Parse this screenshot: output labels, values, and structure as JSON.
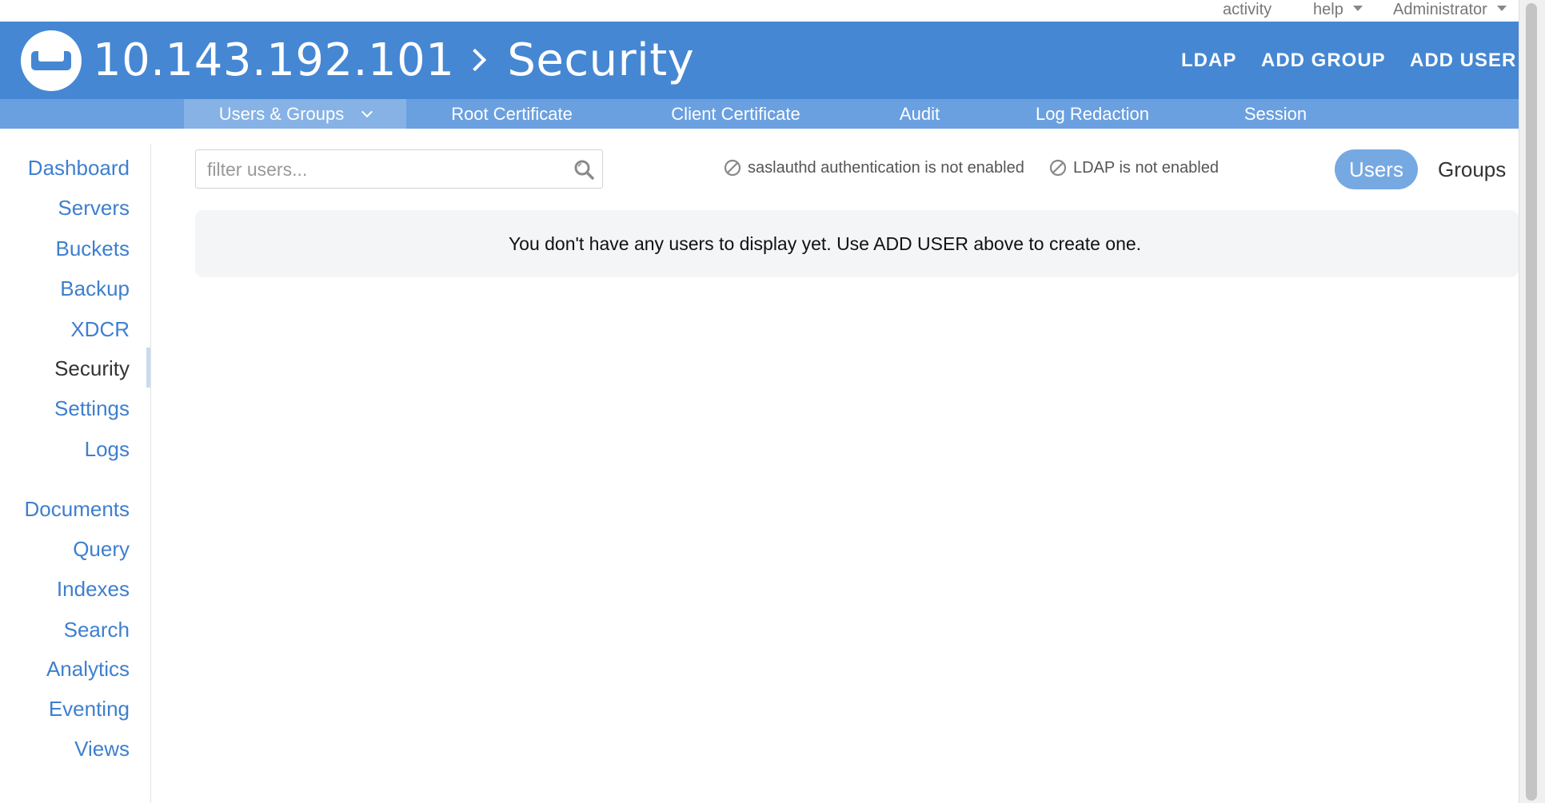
{
  "topbar": {
    "activity": "activity",
    "help": "help",
    "user": "Administrator"
  },
  "header": {
    "host": "10.143.192.101",
    "section": "Security",
    "actions": [
      "LDAP",
      "ADD GROUP",
      "ADD USER"
    ]
  },
  "subnav": {
    "tabs": [
      "Users & Groups",
      "Root Certificate",
      "Client Certificate",
      "Audit",
      "Log Redaction",
      "Session"
    ],
    "active": "Users & Groups"
  },
  "sidebar": {
    "items": [
      "Dashboard",
      "Servers",
      "Buckets",
      "Backup",
      "XDCR",
      "Security",
      "Settings",
      "Logs",
      "Documents",
      "Query",
      "Indexes",
      "Search",
      "Analytics",
      "Eventing",
      "Views"
    ],
    "active": "Security"
  },
  "main": {
    "filter_placeholder": "filter users...",
    "notices": [
      "saslauthd authentication is not enabled",
      "LDAP is not enabled"
    ],
    "toggle": [
      "Users",
      "Groups"
    ],
    "toggle_active": "Users",
    "empty_message": "You don't have any users to display yet. Use ADD USER above to create one."
  },
  "colors": {
    "header": "#4587d3",
    "subnav": "#6aa0e0",
    "link": "#3e7fcf"
  }
}
